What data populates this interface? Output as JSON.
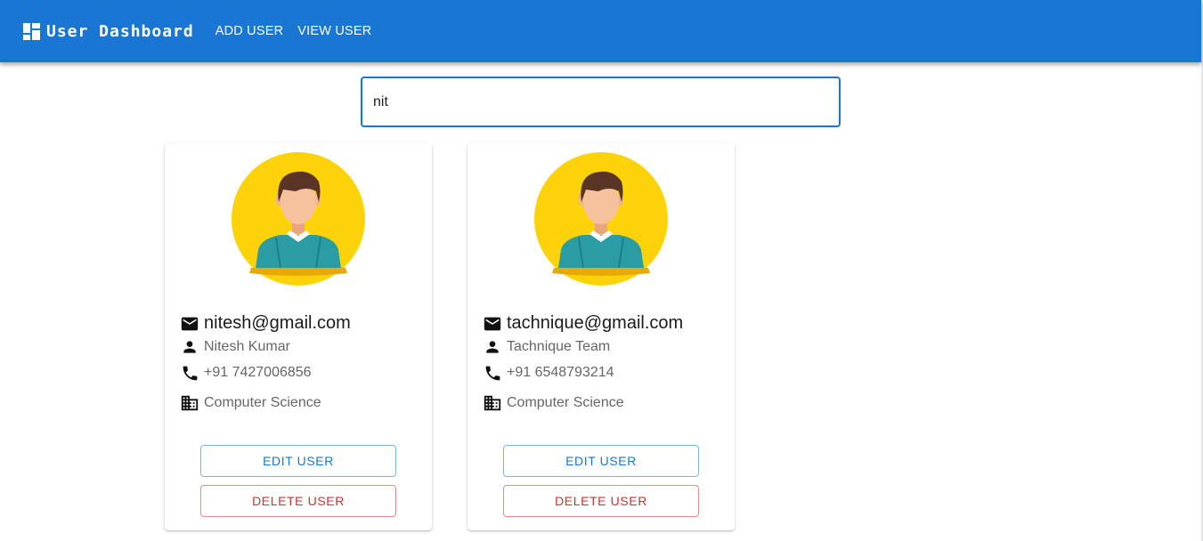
{
  "header": {
    "title": "User Dashboard",
    "nav": [
      "ADD USER",
      "VIEW USER"
    ],
    "background": "#1976d2"
  },
  "search": {
    "value": "nit"
  },
  "cards": [
    {
      "email": "nitesh@gmail.com",
      "name": "Nitesh Kumar",
      "phone": "+91 7427006856",
      "department": "Computer Science",
      "edit_label": "EDIT USER",
      "delete_label": "DELETE USER"
    },
    {
      "email": "tachnique@gmail.com",
      "name": "Tachnique Team",
      "phone": "+91 6548793214",
      "department": "Computer Science",
      "edit_label": "EDIT USER",
      "delete_label": "DELETE USER"
    }
  ],
  "icons": {
    "brand": "dashboard-icon",
    "email": "mail-icon",
    "name": "person-icon",
    "phone": "phone-icon",
    "department": "domain-icon",
    "avatar": "user-avatar"
  },
  "colors": {
    "primary": "#1976d2",
    "danger": "#d32f2f",
    "avatar_bg": "#fcd309"
  }
}
